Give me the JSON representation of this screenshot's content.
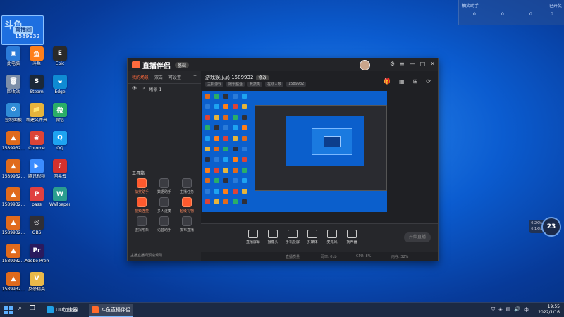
{
  "desktop": {
    "badge": {
      "line1": "斗鱼",
      "line2": "直播间",
      "line3": "1589932"
    },
    "icons": [
      {
        "label": "此电脑",
        "color": "#2b7bd8",
        "glyph": "▣"
      },
      {
        "label": "回收站",
        "color": "#7c8ea8",
        "glyph": "🗑"
      },
      {
        "label": "控制面板",
        "color": "#2f8bd6",
        "glyph": "⚙"
      },
      {
        "label": "1589932...",
        "color": "#e06a1c",
        "glyph": "▲"
      },
      {
        "label": "1589932...",
        "color": "#e06a1c",
        "glyph": "▲"
      },
      {
        "label": "1589932...",
        "color": "#e06a1c",
        "glyph": "▲"
      },
      {
        "label": "1589932...",
        "color": "#e06a1c",
        "glyph": "▲"
      },
      {
        "label": "1589932...",
        "color": "#e06a1c",
        "glyph": "▲"
      },
      {
        "label": "1589932...",
        "color": "#e06a1c",
        "glyph": "▲"
      },
      {
        "label": "斗鱼",
        "color": "#ff7f1a",
        "glyph": "鱼"
      },
      {
        "label": "Steam",
        "color": "#1b2838",
        "glyph": "S"
      },
      {
        "label": "新建文件夹",
        "color": "#e6b43c",
        "glyph": "📁"
      },
      {
        "label": "Chrome",
        "color": "#db4437",
        "glyph": "◉"
      },
      {
        "label": "腾讯视频",
        "color": "#3b8cff",
        "glyph": "▶"
      },
      {
        "label": "pass",
        "color": "#e04040",
        "glyph": "P"
      },
      {
        "label": "OBS",
        "color": "#302f36",
        "glyph": "◎"
      },
      {
        "label": "Adobe Premiere",
        "color": "#2a1a5e",
        "glyph": "Pr"
      },
      {
        "label": "反恐精英",
        "color": "#e9b949",
        "glyph": "V"
      },
      {
        "label": "Epic",
        "color": "#2a2a2a",
        "glyph": "E"
      },
      {
        "label": "Edge",
        "color": "#0f8bd3",
        "glyph": "e"
      },
      {
        "label": "微信",
        "color": "#2aae67",
        "glyph": "微"
      },
      {
        "label": "QQ",
        "color": "#1ea3f1",
        "glyph": "Q"
      },
      {
        "label": "网易云",
        "color": "#d4312d",
        "glyph": "♪"
      },
      {
        "label": "Wallpaper",
        "color": "#2a9d8f",
        "glyph": "W"
      }
    ]
  },
  "top_widget": {
    "left": "抽奖助手",
    "right": "已开奖",
    "a": "0",
    "b": "0",
    "c": "0",
    "d": "0"
  },
  "app": {
    "title": "直播伴侣",
    "plan": "基础",
    "left_tabs": [
      "我的场景",
      "双击",
      "可设置"
    ],
    "scene_label": "场景 1",
    "tools_title": "工具箱",
    "tools": [
      {
        "label": "抽奖助手",
        "hot": true
      },
      {
        "label": "数据助手",
        "hot": false
      },
      {
        "label": "主播任务",
        "hot": false
      },
      {
        "label": "视频连麦",
        "hot": true
      },
      {
        "label": "多人连麦",
        "hot": false
      },
      {
        "label": "超级礼物",
        "hot": true
      },
      {
        "label": "虚拟形象",
        "hot": false
      },
      {
        "label": "语音助手",
        "hot": false
      },
      {
        "label": "发布直播",
        "hot": false
      }
    ],
    "left_footer": "主播直播间预设规则",
    "room_title": "游戏娱乐局 1589932",
    "room_edit": "修改",
    "room_sub": [
      "主机游戏",
      "娱乐整活",
      "竞技类",
      "在线人数",
      "1589932"
    ],
    "bottom_items": [
      "直播屏幕",
      "摄像头",
      "手机投屏",
      "多媒体",
      "麦克风",
      "扬声器"
    ],
    "go_live": "开始直播",
    "status": [
      "直播质量",
      "码率: 0kb",
      "CPU: 8%",
      "内存: 32%"
    ]
  },
  "overlay": {
    "ball": "23",
    "speed_up": "0.2K/s",
    "speed_down": "0.1K/s"
  },
  "taskbar": {
    "buttons": [
      {
        "label": "UU加速器",
        "color": "#1fa0e6",
        "active": false
      },
      {
        "label": "斗鱼直播伴侣",
        "color": "#ff6a2b",
        "active": true
      }
    ],
    "time": "19:55",
    "date": "2022/1/16"
  }
}
